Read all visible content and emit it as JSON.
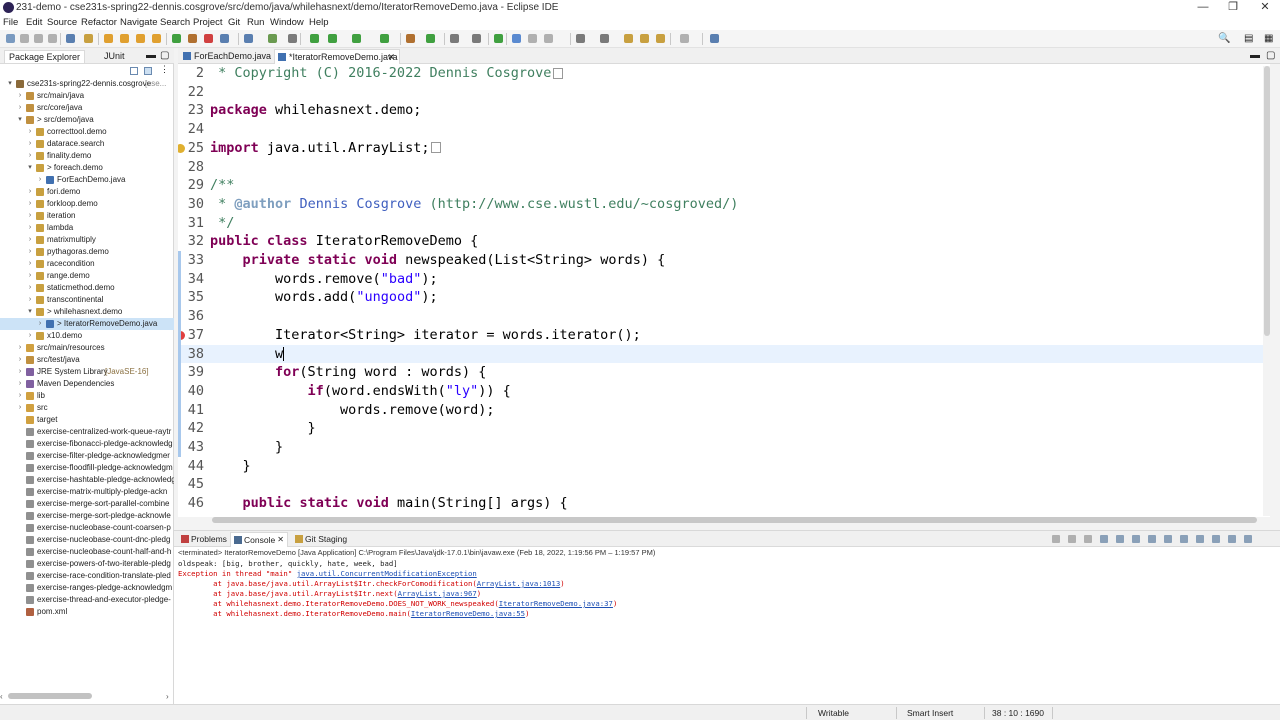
{
  "window": {
    "title": "231-demo - cse231s-spring22-dennis.cosgrove/src/demo/java/whilehasnext/demo/IteratorRemoveDemo.java - Eclipse IDE",
    "minimize": "—",
    "maximize": "❐",
    "close": "✕"
  },
  "menu": [
    "File",
    "Edit",
    "Source",
    "Refactor",
    "Navigate",
    "Search",
    "Project",
    "Git",
    "Run",
    "Window",
    "Help"
  ],
  "left_panel": {
    "tabs": [
      "Package Explorer",
      "JUnit"
    ],
    "project": "cse231s-spring22-dennis.cosgrove",
    "project_suffix": "[cse...",
    "tree": [
      {
        "label": "cse231s-spring22-dennis.cosgrove",
        "level": 0,
        "tw": "▾",
        "icon": "project-icon"
      },
      {
        "label": "src/main/java",
        "level": 1,
        "tw": "›",
        "icon": "source-folder-icon"
      },
      {
        "label": "src/core/java",
        "level": 1,
        "tw": "›",
        "icon": "source-folder-icon"
      },
      {
        "label": "> src/demo/java",
        "level": 1,
        "tw": "▾",
        "icon": "source-folder-icon"
      },
      {
        "label": "correcttool.demo",
        "level": 2,
        "tw": "›",
        "icon": "package-icon"
      },
      {
        "label": "datarace.search",
        "level": 2,
        "tw": "›",
        "icon": "package-icon"
      },
      {
        "label": "finality.demo",
        "level": 2,
        "tw": "›",
        "icon": "package-icon"
      },
      {
        "label": "> foreach.demo",
        "level": 2,
        "tw": "▾",
        "icon": "package-icon"
      },
      {
        "label": "ForEachDemo.java",
        "level": 3,
        "tw": "›",
        "icon": "java-file-icon"
      },
      {
        "label": "fori.demo",
        "level": 2,
        "tw": "›",
        "icon": "package-icon"
      },
      {
        "label": "forkloop.demo",
        "level": 2,
        "tw": "›",
        "icon": "package-icon"
      },
      {
        "label": "iteration",
        "level": 2,
        "tw": "›",
        "icon": "package-icon"
      },
      {
        "label": "lambda",
        "level": 2,
        "tw": "›",
        "icon": "package-icon"
      },
      {
        "label": "matrixmultiply",
        "level": 2,
        "tw": "›",
        "icon": "package-icon"
      },
      {
        "label": "pythagoras.demo",
        "level": 2,
        "tw": "›",
        "icon": "package-icon"
      },
      {
        "label": "racecondition",
        "level": 2,
        "tw": "›",
        "icon": "package-icon"
      },
      {
        "label": "range.demo",
        "level": 2,
        "tw": "›",
        "icon": "package-icon"
      },
      {
        "label": "staticmethod.demo",
        "level": 2,
        "tw": "›",
        "icon": "package-icon"
      },
      {
        "label": "transcontinental",
        "level": 2,
        "tw": "›",
        "icon": "package-icon"
      },
      {
        "label": "> whilehasnext.demo",
        "level": 2,
        "tw": "▾",
        "icon": "package-icon"
      },
      {
        "label": "> IteratorRemoveDemo.java",
        "level": 3,
        "tw": "›",
        "icon": "java-file-icon",
        "selected": true
      },
      {
        "label": "x10.demo",
        "level": 2,
        "tw": "›",
        "icon": "package-icon"
      },
      {
        "label": "src/main/resources",
        "level": 1,
        "tw": "›",
        "icon": "folder-icon"
      },
      {
        "label": "src/test/java",
        "level": 1,
        "tw": "›",
        "icon": "source-folder-icon"
      },
      {
        "label": "JRE System Library",
        "suffix": "[JavaSE-16]",
        "level": 1,
        "tw": "›",
        "icon": "library-icon"
      },
      {
        "label": "Maven Dependencies",
        "level": 1,
        "tw": "›",
        "icon": "library-icon"
      },
      {
        "label": "lib",
        "level": 1,
        "tw": "›",
        "icon": "folder-icon"
      },
      {
        "label": "src",
        "level": 1,
        "tw": "›",
        "icon": "folder-icon"
      },
      {
        "label": "target",
        "level": 1,
        "tw": "",
        "icon": "folder-icon"
      },
      {
        "label": "exercise-centralized-work-queue-raytr",
        "level": 1,
        "tw": "",
        "icon": "text-file-icon"
      },
      {
        "label": "exercise-fibonacci-pledge-acknowledg",
        "level": 1,
        "tw": "",
        "icon": "text-file-icon"
      },
      {
        "label": "exercise-filter-pledge-acknowledgmer",
        "level": 1,
        "tw": "",
        "icon": "text-file-icon"
      },
      {
        "label": "exercise-floodfill-pledge-acknowledgm",
        "level": 1,
        "tw": "",
        "icon": "text-file-icon"
      },
      {
        "label": "exercise-hashtable-pledge-acknowledg",
        "level": 1,
        "tw": "",
        "icon": "text-file-icon"
      },
      {
        "label": "exercise-matrix-multiply-pledge-ackn",
        "level": 1,
        "tw": "",
        "icon": "text-file-icon"
      },
      {
        "label": "exercise-merge-sort-parallel-combine",
        "level": 1,
        "tw": "",
        "icon": "text-file-icon"
      },
      {
        "label": "exercise-merge-sort-pledge-acknowle",
        "level": 1,
        "tw": "",
        "icon": "text-file-icon"
      },
      {
        "label": "exercise-nucleobase-count-coarsen-p",
        "level": 1,
        "tw": "",
        "icon": "text-file-icon"
      },
      {
        "label": "exercise-nucleobase-count-dnc-pledg",
        "level": 1,
        "tw": "",
        "icon": "text-file-icon"
      },
      {
        "label": "exercise-nucleobase-count-half-and-h",
        "level": 1,
        "tw": "",
        "icon": "text-file-icon"
      },
      {
        "label": "exercise-powers-of-two-iterable-pledg",
        "level": 1,
        "tw": "",
        "icon": "text-file-icon"
      },
      {
        "label": "exercise-race-condition-translate-pled",
        "level": 1,
        "tw": "",
        "icon": "text-file-icon"
      },
      {
        "label": "exercise-ranges-pledge-acknowledgm",
        "level": 1,
        "tw": "",
        "icon": "text-file-icon"
      },
      {
        "label": "exercise-thread-and-executor-pledge-",
        "level": 1,
        "tw": "",
        "icon": "text-file-icon"
      },
      {
        "label": "pom.xml",
        "level": 1,
        "tw": "",
        "icon": "xml-file-icon"
      }
    ]
  },
  "editor": {
    "tabs": [
      {
        "label": "ForEachDemo.java",
        "active": false
      },
      {
        "label": "*IteratorRemoveDemo.java",
        "active": true
      }
    ],
    "lines": [
      {
        "num": "2",
        "marker": "fold",
        "tokens": [
          [
            "cm",
            " * Copyright (C) 2016-2022 Dennis Cosgrove"
          ]
        ],
        "box": true
      },
      {
        "num": "22",
        "tokens": []
      },
      {
        "num": "23",
        "tokens": [
          [
            "kw",
            "package"
          ],
          [
            "",
            " whilehasnext.demo;"
          ]
        ]
      },
      {
        "num": "24",
        "tokens": []
      },
      {
        "num": "25",
        "marker": "warn",
        "tokens": [
          [
            "kw",
            "import"
          ],
          [
            "",
            " java.util.ArrayList;"
          ]
        ],
        "box": true
      },
      {
        "num": "28",
        "tokens": []
      },
      {
        "num": "29",
        "marker": "fold",
        "tokens": [
          [
            "cm",
            "/**"
          ]
        ]
      },
      {
        "num": "30",
        "tokens": [
          [
            "cm",
            " * "
          ],
          [
            "an",
            "@author"
          ],
          [
            "cm",
            " "
          ],
          [
            "lnk",
            "Dennis Cosgrove"
          ],
          [
            "cm",
            " (http://www.cse.wustl.edu/~cosgroved/)"
          ]
        ]
      },
      {
        "num": "31",
        "tokens": [
          [
            "cm",
            " */"
          ]
        ]
      },
      {
        "num": "32",
        "tokens": [
          [
            "kw",
            "public"
          ],
          [
            "",
            " "
          ],
          [
            "kw",
            "class"
          ],
          [
            "",
            " IteratorRemoveDemo {"
          ]
        ]
      },
      {
        "num": "33",
        "marker": "fold",
        "tokens": [
          [
            "",
            "    "
          ],
          [
            "kw",
            "private"
          ],
          [
            "",
            " "
          ],
          [
            "kw",
            "static"
          ],
          [
            "",
            " "
          ],
          [
            "kw",
            "void"
          ],
          [
            "",
            " newspeaked(List<String> words) {"
          ]
        ]
      },
      {
        "num": "34",
        "tokens": [
          [
            "",
            "        words.remove("
          ],
          [
            "st",
            "\"bad\""
          ],
          [
            "",
            ");"
          ]
        ]
      },
      {
        "num": "35",
        "tokens": [
          [
            "",
            "        words.add("
          ],
          [
            "st",
            "\"ungood\""
          ],
          [
            "",
            ");"
          ]
        ]
      },
      {
        "num": "36",
        "tokens": []
      },
      {
        "num": "37",
        "marker": "error",
        "tokens": [
          [
            "",
            "        Iterator<String> iterator = words.iterator();"
          ]
        ]
      },
      {
        "num": "38",
        "current": true,
        "tokens": [
          [
            "",
            "        w"
          ]
        ]
      },
      {
        "num": "39",
        "tokens": [
          [
            "",
            "        "
          ],
          [
            "kw",
            "for"
          ],
          [
            "",
            "(String word : words) {"
          ]
        ]
      },
      {
        "num": "40",
        "tokens": [
          [
            "",
            "            "
          ],
          [
            "kw",
            "if"
          ],
          [
            "",
            "(word.endsWith("
          ],
          [
            "st",
            "\"ly\""
          ],
          [
            "",
            ")) {"
          ]
        ]
      },
      {
        "num": "41",
        "tokens": [
          [
            "",
            "                words.remove(word);"
          ]
        ]
      },
      {
        "num": "42",
        "tokens": [
          [
            "",
            "            }"
          ]
        ]
      },
      {
        "num": "43",
        "tokens": [
          [
            "",
            "        }"
          ]
        ]
      },
      {
        "num": "44",
        "tokens": [
          [
            "",
            "    }"
          ]
        ]
      },
      {
        "num": "45",
        "tokens": []
      },
      {
        "num": "46",
        "marker": "fold",
        "tokens": [
          [
            "",
            "    "
          ],
          [
            "kw",
            "public"
          ],
          [
            "",
            " "
          ],
          [
            "kw",
            "static"
          ],
          [
            "",
            " "
          ],
          [
            "kw",
            "void"
          ],
          [
            "",
            " main(String[] args) {"
          ]
        ]
      }
    ]
  },
  "bottom_panel": {
    "tabs": [
      {
        "label": "Problems",
        "active": false
      },
      {
        "label": "Console",
        "active": true
      },
      {
        "label": "Git Staging",
        "active": false
      }
    ],
    "header": "<terminated> IteratorRemoveDemo [Java Application] C:\\Program Files\\Java\\jdk-17.0.1\\bin\\javaw.exe  (Feb 18, 2022, 1:19:56 PM – 1:19:57 PM)",
    "lines": [
      {
        "style": "normal",
        "parts": [
          [
            "",
            "oldspeak: [big, brother, quickly, hate, week, bad]"
          ]
        ]
      },
      {
        "style": "err",
        "parts": [
          [
            "",
            "Exception in thread \"main\" "
          ],
          [
            "link",
            "java.util.ConcurrentModificationException"
          ]
        ]
      },
      {
        "style": "err",
        "parts": [
          [
            "",
            "\tat java.base/java.util.ArrayList$Itr.checkForComodification("
          ],
          [
            "link",
            "ArrayList.java:1013"
          ],
          [
            "",
            ")"
          ]
        ]
      },
      {
        "style": "err",
        "parts": [
          [
            "",
            "\tat java.base/java.util.ArrayList$Itr.next("
          ],
          [
            "link",
            "ArrayList.java:967"
          ],
          [
            "",
            ")"
          ]
        ]
      },
      {
        "style": "err",
        "parts": [
          [
            "",
            "\tat whilehasnext.demo.IteratorRemoveDemo.DOES_NOT_WORK_newspeaked("
          ],
          [
            "link",
            "IteratorRemoveDemo.java:37"
          ],
          [
            "",
            ")"
          ]
        ]
      },
      {
        "style": "err",
        "parts": [
          [
            "",
            "\tat whilehasnext.demo.IteratorRemoveDemo.main("
          ],
          [
            "link",
            "IteratorRemoveDemo.java:55"
          ],
          [
            "",
            ")"
          ]
        ]
      }
    ]
  },
  "status": {
    "writable": "Writable",
    "insert_mode": "Smart Insert",
    "position": "38 : 10 : 1690"
  }
}
